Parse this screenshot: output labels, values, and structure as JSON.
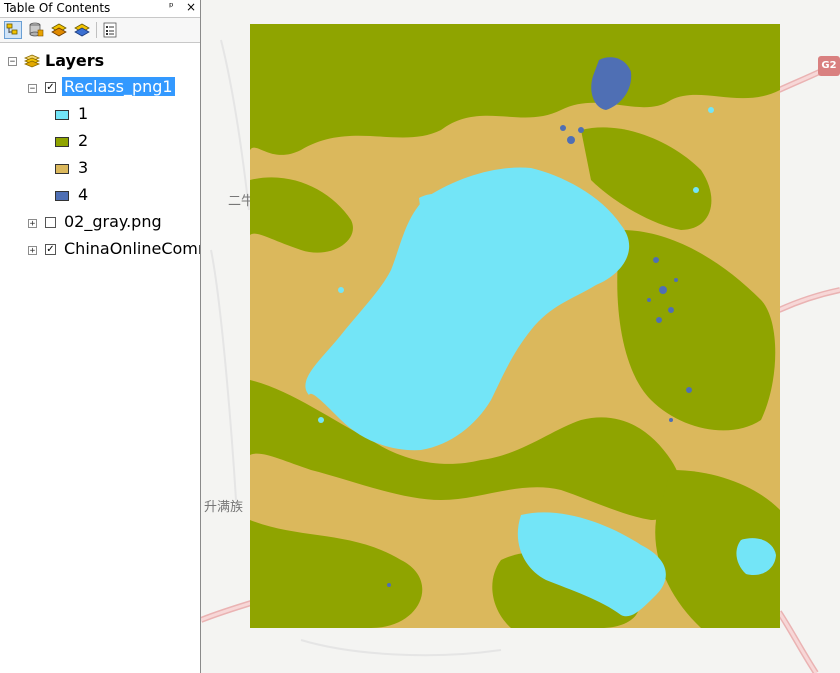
{
  "toc": {
    "title": "Table Of Contents",
    "pin_glyph": "ᵖ",
    "close_glyph": "×",
    "toolbar": [
      {
        "name": "list-by-drawing-order-icon"
      },
      {
        "name": "list-by-source-icon"
      },
      {
        "name": "list-by-visibility-icon"
      },
      {
        "name": "list-by-selection-icon"
      },
      {
        "name": "options-icon"
      }
    ],
    "tree": {
      "root_label": "Layers",
      "layers": [
        {
          "label": "Reclass_png1",
          "checked": true,
          "expanded": true,
          "selected": true
        },
        {
          "label": "02_gray.png",
          "checked": false,
          "expanded": false
        },
        {
          "label": "ChinaOnlineCommunity",
          "checked": true,
          "expanded": false
        }
      ],
      "legend": [
        {
          "label": "1",
          "color": "#73e5f7"
        },
        {
          "label": "2",
          "color": "#8fa400"
        },
        {
          "label": "3",
          "color": "#dbb85c"
        },
        {
          "label": "4",
          "color": "#4f6fb4"
        }
      ]
    }
  },
  "map": {
    "basemap_labels": [
      "二牛",
      "升满族"
    ],
    "road_shield": "G2"
  },
  "colors": {
    "water": "#73e5f7",
    "vegetation": "#8fa400",
    "bare": "#dbb85c",
    "built": "#4f6fb4",
    "selection": "#3399ff",
    "road": "#e8a8a8"
  }
}
